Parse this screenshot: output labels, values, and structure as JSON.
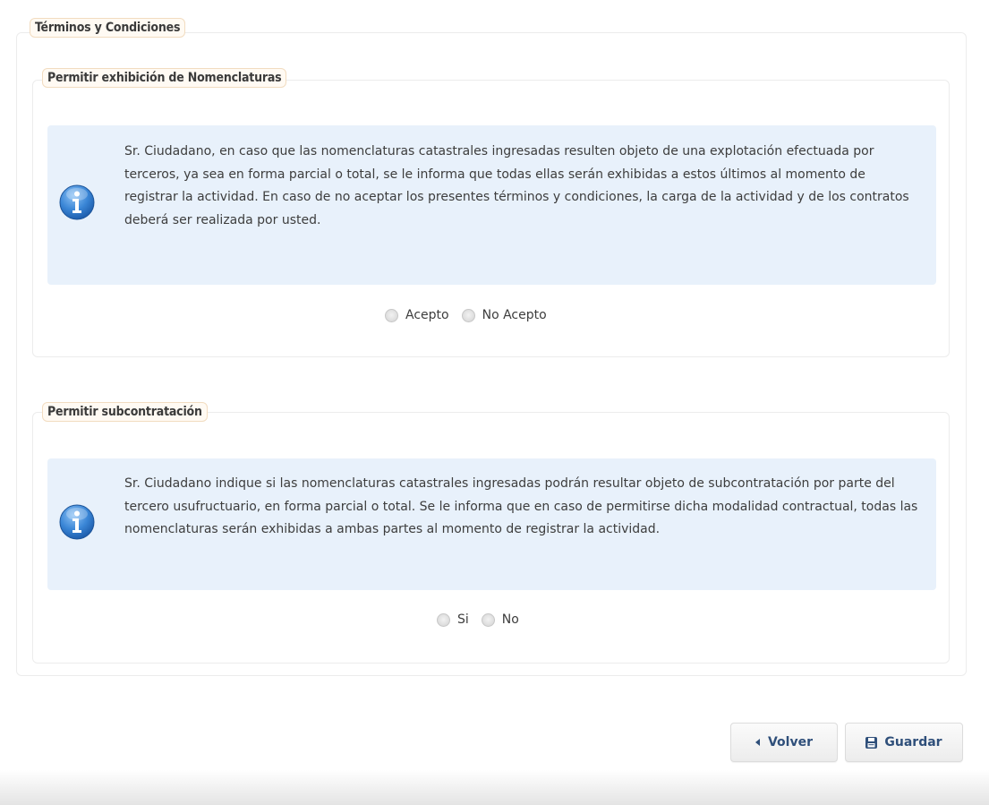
{
  "section": {
    "title": "Términos y Condiciones"
  },
  "nomenclaturas": {
    "legend": "Permitir exhibición de Nomenclaturas",
    "info_text": "Sr. Ciudadano, en caso que las nomenclaturas catastrales ingresadas resulten objeto de una explotación efectuada por terceros, ya sea en forma parcial o total, se le informa que todas ellas serán exhibidas a estos últimos al momento de registrar la actividad. En caso de no aceptar los presentes términos y condiciones, la carga de la actividad y de los contratos deberá ser realizada por usted.",
    "options": [
      "Acepto",
      "No Acepto"
    ],
    "icon": "info-icon"
  },
  "subcontratacion": {
    "legend": "Permitir subcontratación",
    "info_text": "Sr. Ciudadano indique si las nomenclaturas catastrales ingresadas podrán resultar objeto de subcontratación por parte del tercero usufructuario, en forma parcial o total. Se le informa que en caso de permitirse dicha modalidad contractual, todas las nomenclaturas serán exhibidas a ambas partes al momento de registrar la actividad.",
    "options": [
      "Si",
      "No"
    ],
    "icon": "info-icon"
  },
  "actions": {
    "back_label": "Volver",
    "save_label": "Guardar",
    "back_icon": "chevron-left-icon",
    "save_icon": "floppy-disk-icon"
  },
  "colors": {
    "info_bg": "#e8f1fb",
    "legend_bg": "#fffaf3",
    "button_text": "#2f4f7a"
  }
}
